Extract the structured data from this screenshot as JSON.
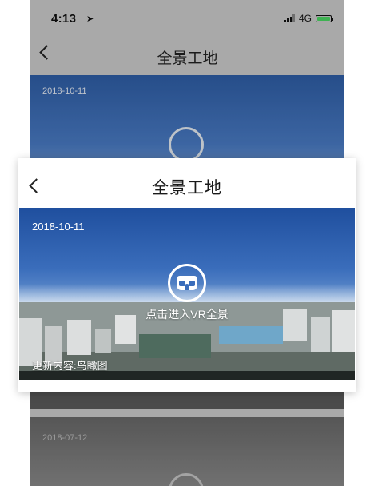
{
  "status_bar": {
    "time": "4:13",
    "network": "4G"
  },
  "background_page": {
    "title": "全景工地",
    "cards": [
      {
        "date": "2018-10-11"
      },
      {
        "date": "2018-07-12"
      }
    ]
  },
  "panel": {
    "title": "全景工地",
    "card": {
      "date": "2018-10-11",
      "vr_label": "点击进入VR全景",
      "update_label": "更新内容:鸟瞰图"
    }
  },
  "colors": {
    "sky_top": "#1f4f9e",
    "sky_mid": "#3a6dbb",
    "battery": "#4cd964"
  },
  "icons": [
    "location-arrow-icon",
    "signal-icon",
    "battery-icon",
    "back-chevron-icon",
    "vr-goggles-icon"
  ]
}
